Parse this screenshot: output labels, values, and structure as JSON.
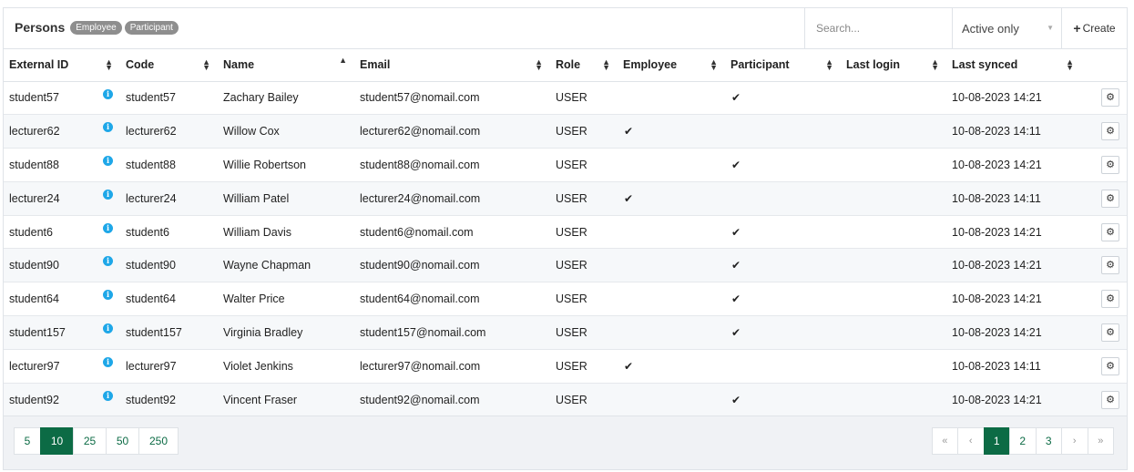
{
  "header": {
    "title": "Persons",
    "badges": [
      "Employee",
      "Participant"
    ],
    "search_placeholder": "Search...",
    "filter_value": "Active only",
    "create_label": "Create"
  },
  "columns": [
    "External ID",
    "Code",
    "Name",
    "Email",
    "Role",
    "Employee",
    "Participant",
    "Last login",
    "Last synced"
  ],
  "check_glyph": "✔",
  "rows": [
    {
      "external_id": "student57",
      "code": "student57",
      "name": "Zachary Bailey",
      "email": "student57@nomail.com",
      "role": "USER",
      "employee": false,
      "participant": true,
      "last_login": "",
      "last_synced": "10-08-2023 14:21"
    },
    {
      "external_id": "lecturer62",
      "code": "lecturer62",
      "name": "Willow Cox",
      "email": "lecturer62@nomail.com",
      "role": "USER",
      "employee": true,
      "participant": false,
      "last_login": "",
      "last_synced": "10-08-2023 14:11"
    },
    {
      "external_id": "student88",
      "code": "student88",
      "name": "Willie Robertson",
      "email": "student88@nomail.com",
      "role": "USER",
      "employee": false,
      "participant": true,
      "last_login": "",
      "last_synced": "10-08-2023 14:21"
    },
    {
      "external_id": "lecturer24",
      "code": "lecturer24",
      "name": "William Patel",
      "email": "lecturer24@nomail.com",
      "role": "USER",
      "employee": true,
      "participant": false,
      "last_login": "",
      "last_synced": "10-08-2023 14:11"
    },
    {
      "external_id": "student6",
      "code": "student6",
      "name": "William Davis",
      "email": "student6@nomail.com",
      "role": "USER",
      "employee": false,
      "participant": true,
      "last_login": "",
      "last_synced": "10-08-2023 14:21"
    },
    {
      "external_id": "student90",
      "code": "student90",
      "name": "Wayne Chapman",
      "email": "student90@nomail.com",
      "role": "USER",
      "employee": false,
      "participant": true,
      "last_login": "",
      "last_synced": "10-08-2023 14:21"
    },
    {
      "external_id": "student64",
      "code": "student64",
      "name": "Walter Price",
      "email": "student64@nomail.com",
      "role": "USER",
      "employee": false,
      "participant": true,
      "last_login": "",
      "last_synced": "10-08-2023 14:21"
    },
    {
      "external_id": "student157",
      "code": "student157",
      "name": "Virginia Bradley",
      "email": "student157@nomail.com",
      "role": "USER",
      "employee": false,
      "participant": true,
      "last_login": "",
      "last_synced": "10-08-2023 14:21"
    },
    {
      "external_id": "lecturer97",
      "code": "lecturer97",
      "name": "Violet Jenkins",
      "email": "lecturer97@nomail.com",
      "role": "USER",
      "employee": true,
      "participant": false,
      "last_login": "",
      "last_synced": "10-08-2023 14:11"
    },
    {
      "external_id": "student92",
      "code": "student92",
      "name": "Vincent Fraser",
      "email": "student92@nomail.com",
      "role": "USER",
      "employee": false,
      "participant": true,
      "last_login": "",
      "last_synced": "10-08-2023 14:21"
    }
  ],
  "footer": {
    "page_sizes": [
      "5",
      "10",
      "25",
      "50",
      "250"
    ],
    "active_page_size": "10",
    "pages": [
      "«",
      "‹",
      "1",
      "2",
      "3",
      "›",
      "»"
    ],
    "active_page": "1"
  },
  "colors": {
    "accent": "#0c6b45",
    "info": "#1ea7e8",
    "badge": "#8e8e8e"
  },
  "icons": {
    "info": "info-icon",
    "gear": "gear-icon",
    "check": "check-icon",
    "plus": "plus-icon",
    "sort": "sort-icon",
    "sort_asc": "sort-asc-icon"
  }
}
